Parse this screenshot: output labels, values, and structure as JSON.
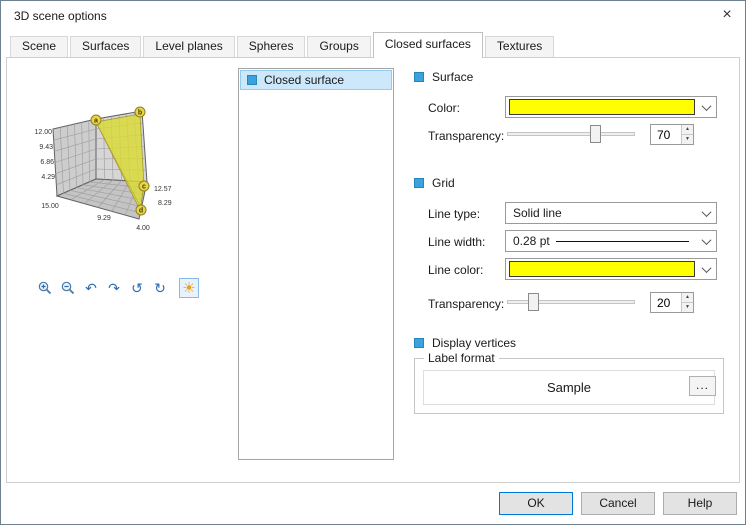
{
  "window": {
    "title": "3D scene options",
    "close_icon": "×"
  },
  "tabs": [
    {
      "label": "Scene",
      "active": false
    },
    {
      "label": "Surfaces",
      "active": false
    },
    {
      "label": "Level planes",
      "active": false
    },
    {
      "label": "Spheres",
      "active": false
    },
    {
      "label": "Groups",
      "active": false
    },
    {
      "label": "Closed surfaces",
      "active": true
    },
    {
      "label": "Textures",
      "active": false
    }
  ],
  "preview": {
    "y_axis_ticks": [
      "12.00",
      "9.43",
      "6.86",
      "4.29"
    ],
    "x_axis_ticks": [
      "15.00",
      "9.29",
      "4.00"
    ],
    "z_axis_ticks": [
      "12.57",
      "8.29"
    ],
    "vertex_labels": [
      "a",
      "b",
      "c",
      "d"
    ],
    "surface_color": "#dcdc32"
  },
  "toolbar": {
    "icons": [
      {
        "name": "zoom-in"
      },
      {
        "name": "zoom-out"
      },
      {
        "name": "rotate-left",
        "glyph": "↶"
      },
      {
        "name": "rotate-right",
        "glyph": "↷"
      },
      {
        "name": "spin-left",
        "glyph": "↺"
      },
      {
        "name": "spin-right",
        "glyph": "↻"
      },
      {
        "name": "lighting",
        "glyph": "☀",
        "selected": true
      }
    ]
  },
  "list": {
    "items": [
      {
        "label": "Closed surface",
        "selected": true
      }
    ]
  },
  "surface": {
    "title": "Surface",
    "checked": true,
    "color_label": "Color:",
    "color_value": "#ffff00",
    "transparency_label": "Transparency:",
    "transparency_value": "70"
  },
  "grid": {
    "title": "Grid",
    "checked": true,
    "line_type_label": "Line type:",
    "line_type_value": "Solid line",
    "line_width_label": "Line width:",
    "line_width_value": "0.28 pt",
    "line_color_label": "Line color:",
    "line_color_value": "#ffff00",
    "transparency_label": "Transparency:",
    "transparency_value": "20"
  },
  "vertices": {
    "label": "Display vertices",
    "checked": true
  },
  "label_format": {
    "legend": "Label format",
    "sample": "Sample",
    "more_label": "..."
  },
  "spinner": {
    "up": "▲",
    "down": "▼"
  },
  "buttons": {
    "ok": "OK",
    "cancel": "Cancel",
    "help": "Help"
  }
}
